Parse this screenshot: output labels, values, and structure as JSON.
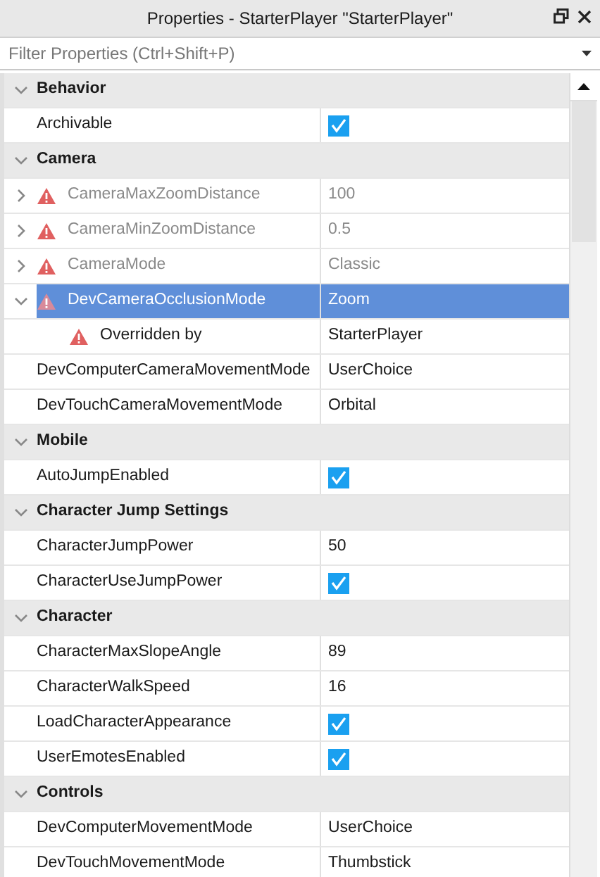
{
  "window": {
    "title": "Properties - StarterPlayer \"StarterPlayer\""
  },
  "filter": {
    "placeholder": "Filter Properties (Ctrl+Shift+P)"
  },
  "sections": [
    {
      "title": "Behavior",
      "expanded": true,
      "properties": [
        {
          "name": "Archivable",
          "kind": "checkbox",
          "checked": true,
          "selected": false
        }
      ]
    },
    {
      "title": "Camera",
      "expanded": true,
      "properties": [
        {
          "name": "CameraMaxZoomDistance",
          "kind": "text",
          "value": "100",
          "warning": true,
          "disabled": true,
          "expanded": false,
          "selected": false
        },
        {
          "name": "CameraMinZoomDistance",
          "kind": "text",
          "value": "0.5",
          "warning": true,
          "disabled": true,
          "expanded": false,
          "selected": false
        },
        {
          "name": "CameraMode",
          "kind": "text",
          "value": "Classic",
          "warning": true,
          "disabled": true,
          "expanded": false,
          "selected": false
        },
        {
          "name": "DevCameraOcclusionMode",
          "kind": "text",
          "value": "Zoom",
          "warning": true,
          "expanded": true,
          "selected": true,
          "children": [
            {
              "name": "Overridden by",
              "kind": "text",
              "value": "StarterPlayer",
              "warning": true,
              "selected": false
            }
          ]
        },
        {
          "name": "DevComputerCameraMovementMode",
          "kind": "text",
          "value": "UserChoice",
          "selected": false
        },
        {
          "name": "DevTouchCameraMovementMode",
          "kind": "text",
          "value": "Orbital",
          "selected": false
        }
      ]
    },
    {
      "title": "Mobile",
      "expanded": true,
      "properties": [
        {
          "name": "AutoJumpEnabled",
          "kind": "checkbox",
          "checked": true,
          "selected": false
        }
      ]
    },
    {
      "title": "Character Jump Settings",
      "expanded": true,
      "properties": [
        {
          "name": "CharacterJumpPower",
          "kind": "text",
          "value": "50",
          "selected": false
        },
        {
          "name": "CharacterUseJumpPower",
          "kind": "checkbox",
          "checked": true,
          "selected": false
        }
      ]
    },
    {
      "title": "Character",
      "expanded": true,
      "properties": [
        {
          "name": "CharacterMaxSlopeAngle",
          "kind": "text",
          "value": "89",
          "selected": false
        },
        {
          "name": "CharacterWalkSpeed",
          "kind": "text",
          "value": "16",
          "selected": false
        },
        {
          "name": "LoadCharacterAppearance",
          "kind": "checkbox",
          "checked": true,
          "selected": false
        },
        {
          "name": "UserEmotesEnabled",
          "kind": "checkbox",
          "checked": true,
          "selected": false
        }
      ]
    },
    {
      "title": "Controls",
      "expanded": true,
      "properties": [
        {
          "name": "DevComputerMovementMode",
          "kind": "text",
          "value": "UserChoice",
          "selected": false
        },
        {
          "name": "DevTouchMovementMode",
          "kind": "text",
          "value": "Thumbstick",
          "selected": false
        }
      ]
    }
  ]
}
